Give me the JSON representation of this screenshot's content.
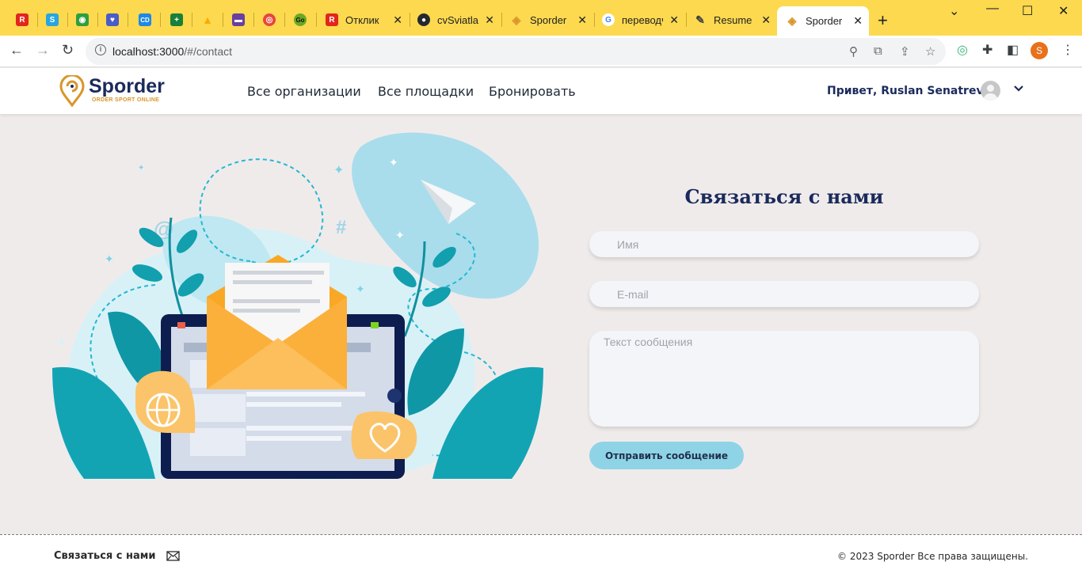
{
  "browser": {
    "tabs": [
      {
        "icon": "R",
        "color": "#e2261c",
        "title": ""
      },
      {
        "icon": "S",
        "color": "#27a6e0",
        "title": ""
      },
      {
        "icon": "◉",
        "color": "#2e9e3e",
        "title": ""
      },
      {
        "icon": "♥",
        "color": "#4a5cc7",
        "title": ""
      },
      {
        "icon": "CD",
        "color": "#1e88e5",
        "title": ""
      },
      {
        "icon": "+",
        "color": "#188038",
        "title": ""
      },
      {
        "icon": "▲",
        "color": "#f9ab00",
        "title": ""
      },
      {
        "icon": "▬",
        "color": "#6a3fa0",
        "title": ""
      },
      {
        "icon": "◎",
        "color": "#e8453c",
        "title": ""
      },
      {
        "icon": "Go",
        "color": "#6aa822",
        "title": ""
      },
      {
        "icon": "R",
        "color": "#e2261c",
        "title": "Отклик"
      },
      {
        "icon": "●",
        "color": "#24292e",
        "title": "cvSviatlana"
      },
      {
        "icon": "◈",
        "color": "#d9962a",
        "title": "Sporder"
      },
      {
        "icon": "G",
        "color": "#4285f4",
        "title": "переводчик"
      },
      {
        "icon": "✎",
        "color": "#3c4043",
        "title": "Resume"
      },
      {
        "icon": "◈",
        "color": "#d9962a",
        "title": "Sporder"
      }
    ],
    "url_host": "localhost:3000",
    "url_path": "/#/contact",
    "profile_initial": "S"
  },
  "header": {
    "logo_title": "Sporder",
    "logo_subtitle": "ORDER SPORT ONLINE",
    "nav": [
      "Все организации",
      "Все площадки",
      "Бронировать"
    ],
    "greeting": "Привет, Ruslan Senatrev!"
  },
  "contact": {
    "title": "Связаться с нами",
    "name_placeholder": "Имя",
    "email_placeholder": "E-mail",
    "message_placeholder": "Текст сообщения",
    "submit_label": "Отправить сообщение"
  },
  "footer": {
    "contact_label": "Связаться с нами",
    "copyright": "© 2023 Sporder  Все права защищены."
  }
}
